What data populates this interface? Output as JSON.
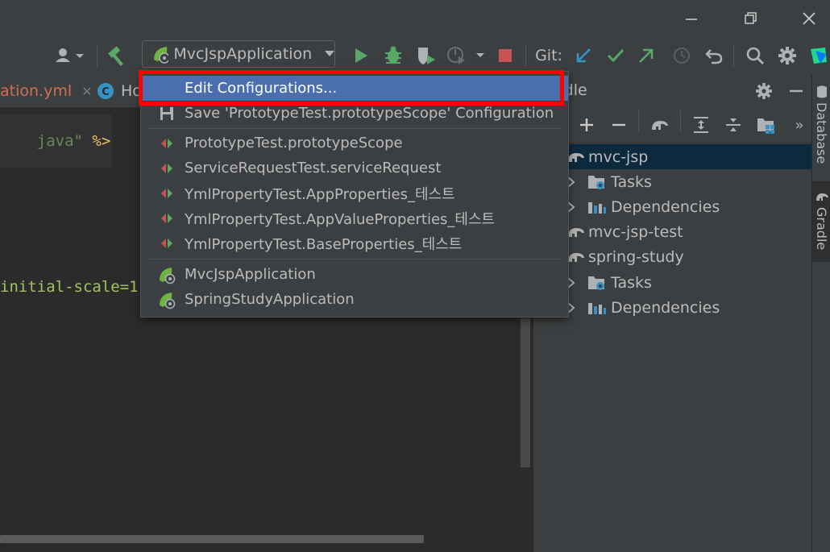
{
  "window": {
    "minimize": "—",
    "restore": "❐",
    "close": "✕"
  },
  "toolbar": {
    "run_config": "MvcJspApplication",
    "git_label": "Git:"
  },
  "tabs": [
    {
      "label": "ation.yml",
      "close": "✕"
    },
    {
      "label": "Ho"
    }
  ],
  "editor": {
    "line1_str": "java\"",
    "line1_tag": " %>",
    "line2": "initial-scale=1"
  },
  "gradle": {
    "title": "adle",
    "tree": [
      {
        "label": "mvc-jsp",
        "type": "project"
      },
      {
        "label": "Tasks",
        "type": "folder"
      },
      {
        "label": "Dependencies",
        "type": "deps"
      },
      {
        "label": "mvc-jsp-test",
        "type": "project"
      },
      {
        "label": "spring-study",
        "type": "project"
      },
      {
        "label": "Tasks",
        "type": "folder"
      },
      {
        "label": "Dependencies",
        "type": "deps"
      }
    ]
  },
  "sidebar": {
    "database": "Database",
    "gradle": "Gradle"
  },
  "menu": {
    "items": [
      {
        "label": "Edit Configurations...",
        "selected": true
      },
      {
        "label": "Save 'PrototypeTest.prototypeScope' Configuration"
      },
      {
        "label": "PrototypeTest.prototypeScope"
      },
      {
        "label": "ServiceRequestTest.serviceRequest"
      },
      {
        "label": "YmlPropertyTest.AppProperties_테스트"
      },
      {
        "label": "YmlPropertyTest.AppValueProperties_테스트"
      },
      {
        "label": "YmlPropertyTest.BaseProperties_테스트"
      },
      {
        "label": "MvcJspApplication"
      },
      {
        "label": "SpringStudyApplication"
      }
    ]
  },
  "colors": {
    "accent": "#4b6eaf",
    "highlight": "#ff0000",
    "run_green": "#59a869",
    "stop_red": "#c75450"
  }
}
